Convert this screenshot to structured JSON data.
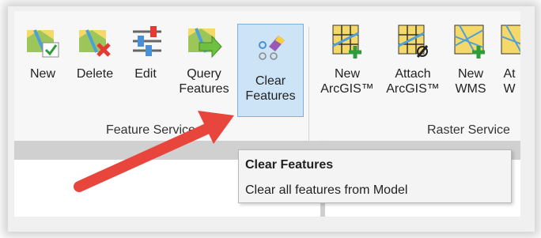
{
  "ribbon": {
    "buttons": [
      {
        "label": "New"
      },
      {
        "label": "Delete"
      },
      {
        "label": "Edit"
      },
      {
        "label_line1": "Query",
        "label_line2": "Features"
      },
      {
        "label_line1": "Clear",
        "label_line2": "Features"
      },
      {
        "label_line1": "New",
        "label_line2": "ArcGIS™"
      },
      {
        "label_line1": "Attach",
        "label_line2": "ArcGIS™"
      },
      {
        "label_line1": "New",
        "label_line2": "WMS"
      },
      {
        "label_line1": "At",
        "label_line2": "W"
      }
    ],
    "groups": [
      "Feature Services",
      "Raster Service"
    ]
  },
  "tooltip": {
    "title": "Clear Features",
    "description": "Clear all features from Model"
  },
  "colors": {
    "selected_bg": "#cde4f7",
    "arrow": "#e8453c",
    "accent_green": "#4caf50",
    "accent_red": "#e53935"
  }
}
